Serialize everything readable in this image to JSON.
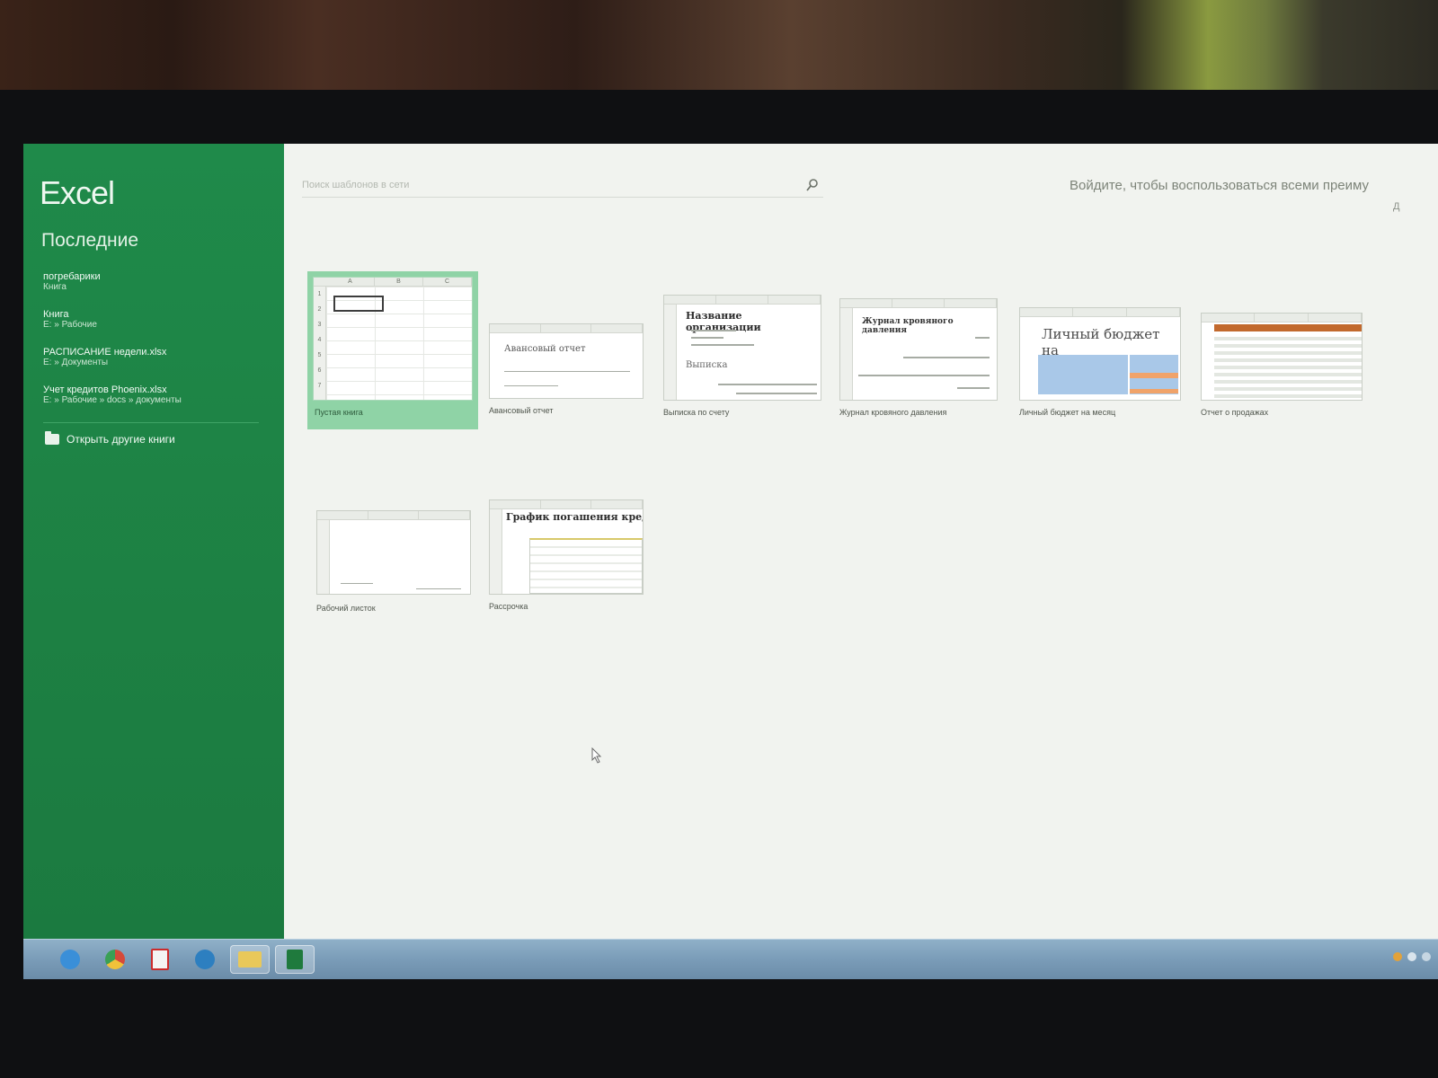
{
  "app": {
    "title": "Excel"
  },
  "sidebar": {
    "recent_title": "Последние",
    "recent_items": [
      {
        "name": "погребарики",
        "path": "Книга"
      },
      {
        "name": "Книга",
        "path": "E: » Рабочие"
      },
      {
        "name": "РАСПИСАНИЕ недели.xlsx",
        "path": "E: » Документы"
      },
      {
        "name": "Учет кредитов Phoenix.xlsx",
        "path": "E: » Рабочие » docs » документы"
      }
    ],
    "open_other_label": "Открыть другие книги"
  },
  "search": {
    "placeholder": "Поиск шаблонов в сети"
  },
  "account": {
    "signin_text": "Войдите, чтобы воспользоваться всеми преиму",
    "signin_sub": "Д"
  },
  "templates": [
    {
      "caption": "Пустая книга"
    },
    {
      "caption": "Авансовый отчет",
      "thumb_title": "Авансовый отчет"
    },
    {
      "caption": "Выписка по счету",
      "thumb_title": "Название организации",
      "thumb_sub": "Выписка"
    },
    {
      "caption": "Журнал кровяного давления",
      "thumb_title": "Журнал кровяного давления"
    },
    {
      "caption": "Личный бюджет на месяц",
      "thumb_title": "Личный бюджет на"
    },
    {
      "caption": "Отчет о продажах"
    },
    {
      "caption": "Рабочий листок"
    },
    {
      "caption": "Рассрочка",
      "thumb_title": "График погашения кред"
    }
  ],
  "columns": [
    "A",
    "B",
    "C"
  ],
  "rows": [
    "1",
    "2",
    "3",
    "4",
    "5",
    "6",
    "7"
  ],
  "taskbar": {
    "apps": [
      {
        "icon": "ie-icon",
        "color": "#3a8fd8"
      },
      {
        "icon": "chrome-icon",
        "color": "#d64a3a"
      },
      {
        "icon": "acrobat-icon",
        "color": "#cc2b2b"
      },
      {
        "icon": "media-player-icon",
        "color": "#2d7fc0"
      },
      {
        "icon": "explorer-icon",
        "color": "#e9c85a"
      },
      {
        "icon": "excel-icon",
        "color": "#1f7a3d"
      }
    ]
  },
  "colors": {
    "accent": "#1f8a4a",
    "selected_tile": "#8fd3a6",
    "taskbar": "#7a9cb8"
  }
}
